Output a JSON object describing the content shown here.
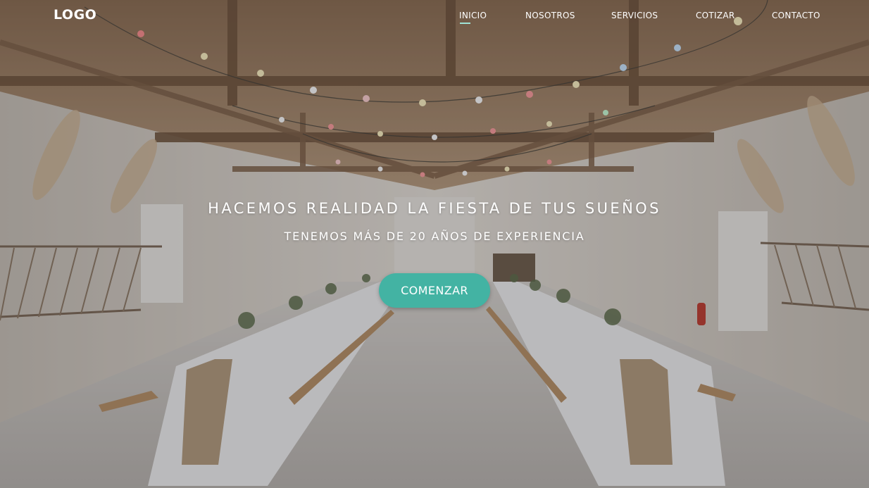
{
  "brand": {
    "logo_text": "LOGO"
  },
  "nav": {
    "items": [
      {
        "label": "INICIO",
        "active": true
      },
      {
        "label": "NOSOTROS",
        "active": false
      },
      {
        "label": "SERVICIOS",
        "active": false
      },
      {
        "label": "COTIZAR",
        "active": false
      },
      {
        "label": "CONTACTO",
        "active": false
      }
    ]
  },
  "hero": {
    "headline": "HACEMOS REALIDAD LA FIESTA DE TUS SUEÑOS",
    "subheadline": "TENEMOS MÁS DE 20 AÑOS DE EXPERIENCIA",
    "cta_label": "COMENZAR",
    "background_image": "venue-hall-with-long-tables-photo"
  },
  "colors": {
    "accent": "#43b3a3",
    "active_underline": "#9fe3d6",
    "overlay": "#28262d"
  }
}
